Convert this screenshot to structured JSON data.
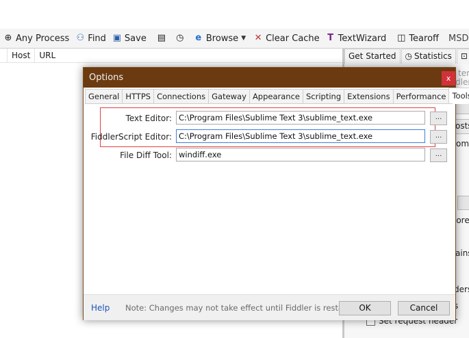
{
  "toolbar": {
    "items": [
      {
        "label": "Any Process",
        "icon": "crosshair-icon"
      },
      {
        "label": "Find",
        "icon": "binoculars-icon"
      },
      {
        "label": "Save",
        "icon": "save-icon"
      },
      {
        "label": "",
        "icon": "camera-icon"
      },
      {
        "label": "",
        "icon": "timer-icon"
      },
      {
        "label": "Browse",
        "icon": "ie-icon"
      },
      {
        "label": "Clear Cache",
        "icon": "clear-cache-icon"
      },
      {
        "label": "TextWizard",
        "icon": "textwizard-icon"
      },
      {
        "label": "Tearoff",
        "icon": "tearoff-icon"
      },
      {
        "label": "MSDN Sear",
        "icon": ""
      }
    ]
  },
  "session_list": {
    "columns": [
      "Host",
      "URL"
    ]
  },
  "right_pane": {
    "tabs": [
      "Get Started",
      "Statistics",
      "In"
    ],
    "fragments": [
      "ters",
      "dlerS",
      "osts",
      "om;",
      "lore",
      "ains",
      "ders",
      "s"
    ],
    "checkbox_label": "Set request header"
  },
  "dialog": {
    "title": "Options",
    "close_label": "x",
    "tabs": [
      "General",
      "HTTPS",
      "Connections",
      "Gateway",
      "Appearance",
      "Scripting",
      "Extensions",
      "Performance",
      "Tools"
    ],
    "active_tab": "Tools",
    "fields": [
      {
        "label": "Text Editor:",
        "value": "C:\\Program Files\\Sublime Text 3\\sublime_text.exe"
      },
      {
        "label": "FiddlerScript Editor:",
        "value": "C:\\Program Files\\Sublime Text 3\\sublime_text.exe"
      },
      {
        "label": "File Diff Tool:",
        "value": "windiff.exe"
      }
    ],
    "browse_label": "...",
    "help_label": "Help",
    "note": "Note: Changes may not take effect until Fiddler is restarted.",
    "ok_label": "OK",
    "cancel_label": "Cancel",
    "highlight_color": "#e04040",
    "title_bar_color": "#6b3a10"
  }
}
